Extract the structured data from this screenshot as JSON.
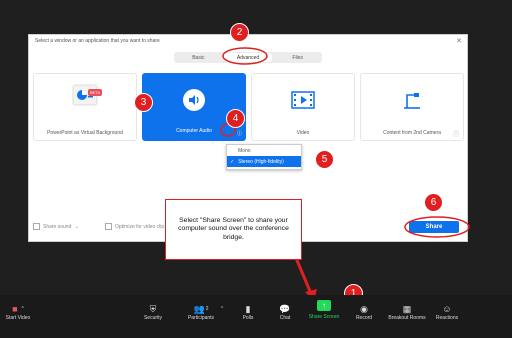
{
  "dialog": {
    "title": "Select a window or an application that you want to share",
    "close": "✕",
    "tabs": [
      "Basic",
      "Advanced",
      "Files"
    ],
    "cards": [
      {
        "label": "PowerPoint as Virtual Background",
        "badge": "BETA"
      },
      {
        "label": "Computer Audio"
      },
      {
        "label": "Video"
      },
      {
        "label": "Content from 2nd Camera"
      }
    ],
    "dropdown": {
      "items": [
        "Mono",
        "Stereo (High-fidelity)"
      ],
      "selected": "Stereo (High-fidelity)"
    },
    "share_sound": "Share sound",
    "optimize_video": "Optimize for video clip",
    "share_button": "Share"
  },
  "callout": {
    "text": "Select \"Share Screen\" to share your computer sound over the conference bridge."
  },
  "steps": [
    "1",
    "2",
    "3",
    "4",
    "5",
    "6"
  ],
  "toolbar": {
    "start_video": "Start Video",
    "security": "Security",
    "participants": "Participants",
    "participants_count": "2",
    "polls": "Polls",
    "chat": "Chat",
    "share_screen": "Share Screen",
    "record": "Record",
    "breakout": "Breakout Rooms",
    "reactions": "Reactions"
  },
  "colors": {
    "accent": "#0e72ed",
    "annotation": "#e02020",
    "share_green": "#23d959"
  }
}
